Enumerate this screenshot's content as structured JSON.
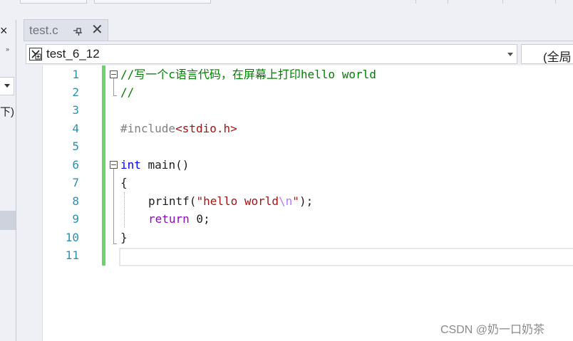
{
  "left_panel": {
    "close_glyph": "×",
    "scroll_glyph": "››",
    "partial_text": "下)"
  },
  "tab": {
    "filename": "test.c",
    "close_glyph": "✕"
  },
  "nav": {
    "project": "test_6_12",
    "scope": "(全局"
  },
  "editor": {
    "line_numbers": [
      "1",
      "2",
      "3",
      "4",
      "5",
      "6",
      "7",
      "8",
      "9",
      "10",
      "11"
    ],
    "code": {
      "l1_comment": "//写一个c语言代码，在屏幕上打印hello world",
      "l2_comment": "//",
      "l4_directive": "#include",
      "l4_header": "<stdio.h>",
      "l6_type": "int",
      "l6_rest": " main()",
      "l7": "{",
      "l8_func": "printf(",
      "l8_str_a": "\"hello world",
      "l8_esc": "\\n",
      "l8_str_b": "\"",
      "l8_end": ");",
      "l9_kw": "return",
      "l9_rest": " 0;",
      "l10": "}"
    }
  },
  "watermark": "CSDN @奶一口奶茶",
  "icons": {
    "tab_pin": "pin-icon",
    "nav_scope": "class-view-icon"
  },
  "colors": {
    "comment": "#008000",
    "keyword": "#0000ff",
    "control": "#8f08c4",
    "string": "#a31515",
    "line_number": "#2b91af",
    "change_bar": "#6fd36c"
  }
}
